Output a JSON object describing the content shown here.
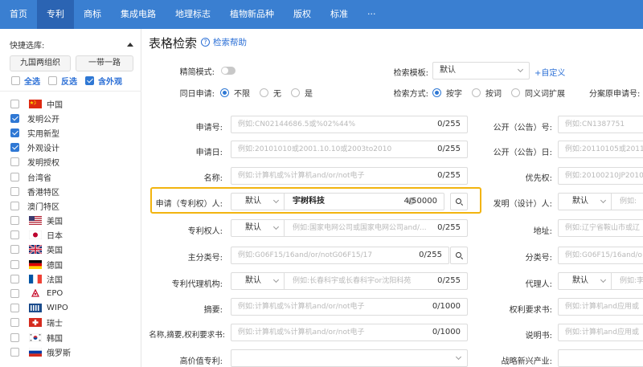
{
  "nav": {
    "items": [
      "首页",
      "专利",
      "商标",
      "集成电路",
      "地理标志",
      "植物新品种",
      "版权",
      "标准",
      "···"
    ],
    "active_index": 1
  },
  "sidebar": {
    "quick_title": "快捷选库:",
    "quick_buttons": [
      "九国两组织",
      "一带一路"
    ],
    "select_all": "全选",
    "invert": "反选",
    "include_design": "含外观",
    "include_design_checked": true,
    "regions": [
      {
        "label": "中国",
        "checked": false,
        "flag": "cn-flag"
      },
      {
        "label": "发明公开",
        "checked": true,
        "sub": true
      },
      {
        "label": "实用新型",
        "checked": true,
        "sub": true
      },
      {
        "label": "外观设计",
        "checked": true,
        "sub": true
      },
      {
        "label": "发明授权",
        "checked": false,
        "sub": true
      },
      {
        "label": "台湾省",
        "checked": false,
        "sub": true
      },
      {
        "label": "香港特区",
        "checked": false,
        "sub": true
      },
      {
        "label": "澳门特区",
        "checked": false,
        "sub": true
      },
      {
        "label": "美国",
        "checked": false,
        "flag": "us-flag"
      },
      {
        "label": "日本",
        "checked": false,
        "flag": "jp-flag"
      },
      {
        "label": "英国",
        "checked": false,
        "flag": "uk-flag"
      },
      {
        "label": "德国",
        "checked": false,
        "flag": "de-flag"
      },
      {
        "label": "法国",
        "checked": false,
        "flag": "fr-flag"
      },
      {
        "label": "EPO",
        "checked": false,
        "flag": "epo-flag"
      },
      {
        "label": "WIPO",
        "checked": false,
        "flag": "wipo-flag"
      },
      {
        "label": "瑞士",
        "checked": false,
        "flag": "ch-flag"
      },
      {
        "label": "韩国",
        "checked": false,
        "flag": "kr-flag"
      },
      {
        "label": "俄罗斯",
        "checked": false,
        "flag": "ru-flag"
      }
    ]
  },
  "main": {
    "title": "表格检索",
    "help": "检索帮助",
    "simple_mode_label": "精简模式:",
    "template_label": "检索模板:",
    "template_value": "默认",
    "add_custom": "+自定义",
    "same_day_label": "同日申请:",
    "same_day_options": [
      "不限",
      "无",
      "是"
    ],
    "search_method_label": "检索方式:",
    "search_method_options": [
      "按字",
      "按词",
      "同义词扩展"
    ],
    "divisional_label": "分案原申请号:",
    "default_option": "默认",
    "left_fields": [
      {
        "label": "申请号:",
        "placeholder": "例如:CN02144686.5或%02%44%",
        "count": "0/255"
      },
      {
        "label": "申请日:",
        "placeholder": "例如:20101010或2001.10.10或2003to2010",
        "count": "0/255"
      },
      {
        "label": "名称:",
        "placeholder": "例如:计算机或%计算机and/or/not电子",
        "count": "0/255"
      },
      {
        "label": "申请（专利权）人:",
        "value": "宇树科技",
        "count": "4/50000"
      },
      {
        "label": "专利权人:",
        "placeholder": "例如:国家电网公司或国家电网公司and/...",
        "count": "0/255"
      },
      {
        "label": "主分类号:",
        "placeholder": "例如:G06F15/16and/or/notG06F15/17",
        "count": "0/255"
      },
      {
        "label": "专利代理机构:",
        "placeholder": "例如:长春科宇或长春科宇or沈阳科苑",
        "count": "0/255"
      },
      {
        "label": "摘要:",
        "placeholder": "例如:计算机或%计算机and/or/not电子",
        "count": "0/1000"
      },
      {
        "label": "名称,摘要,权利要求书:",
        "placeholder": "例如:计算机或%计算机and/or/not电子",
        "count": "0/1000"
      },
      {
        "label": "高价值专利:",
        "placeholder": ""
      }
    ],
    "right_fields": [
      {
        "label": "公开（公告）号:",
        "placeholder": "例如:CN1387751"
      },
      {
        "label": "公开（公告）日:",
        "placeholder": "例如:20110105或2011.0"
      },
      {
        "label": "优先权:",
        "placeholder": "例如:20100210JP2010-"
      },
      {
        "label": "发明（设计）人:",
        "placeholder": "例如:"
      },
      {
        "label": "地址:",
        "placeholder": "例如:辽宁省鞍山市或辽"
      },
      {
        "label": "分类号:",
        "placeholder": "例如:G06F15/16and/o"
      },
      {
        "label": "代理人:",
        "placeholder": "例如:李"
      },
      {
        "label": "权利要求书:",
        "placeholder": "例如:计算机and应用或"
      },
      {
        "label": "说明书:",
        "placeholder": "例如:计算机and应用或"
      },
      {
        "label": "战略新兴产业:",
        "placeholder": ""
      }
    ]
  },
  "colors": {
    "nav_bg": "#3a7fd1",
    "nav_active": "#2b64b3",
    "accent": "#2f78d4",
    "highlight": "#f2b40f"
  }
}
